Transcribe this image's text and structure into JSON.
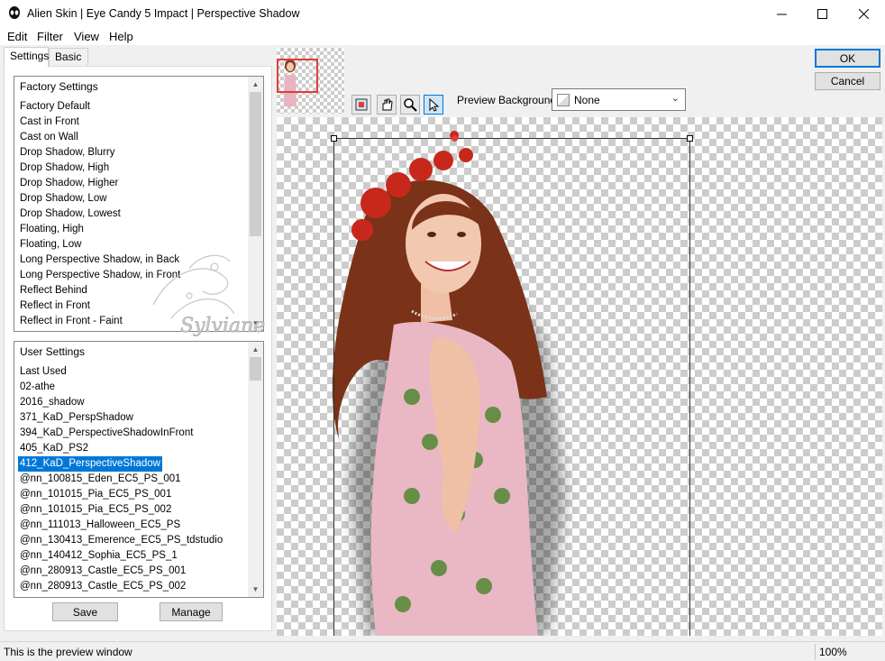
{
  "window": {
    "title": "Alien Skin | Eye Candy 5 Impact | Perspective Shadow"
  },
  "menu": {
    "edit": "Edit",
    "filter": "Filter",
    "view": "View",
    "help": "Help"
  },
  "tabs": {
    "settings": "Settings",
    "basic": "Basic"
  },
  "factory": {
    "header": "Factory Settings",
    "items": [
      "Factory Default",
      "Cast in Front",
      "Cast on Wall",
      "Drop Shadow, Blurry",
      "Drop Shadow, High",
      "Drop Shadow, Higher",
      "Drop Shadow, Low",
      "Drop Shadow, Lowest",
      "Floating, High",
      "Floating, Low",
      "Long Perspective Shadow, in Back",
      "Long Perspective Shadow, in Front",
      "Reflect Behind",
      "Reflect in Front",
      "Reflect in Front - Faint"
    ]
  },
  "user": {
    "header": "User Settings",
    "items": [
      "Last Used",
      "02-athe",
      "2016_shadow",
      "371_KaD_PerspShadow",
      "394_KaD_PerspectiveShadowInFront",
      "405_KaD_PS2",
      "412_KaD_PerspectiveShadow",
      "@nn_100815_Eden_EC5_PS_001",
      "@nn_101015_Pia_EC5_PS_001",
      "@nn_101015_Pia_EC5_PS_002",
      "@nn_111013_Halloween_EC5_PS",
      "@nn_130413_Emerence_EC5_PS_tdstudio",
      "@nn_140412_Sophia_EC5_PS_1",
      "@nn_280913_Castle_EC5_PS_001",
      "@nn_280913_Castle_EC5_PS_002"
    ],
    "selected_index": 6
  },
  "buttons": {
    "save": "Save",
    "manage": "Manage",
    "ok": "OK",
    "cancel": "Cancel"
  },
  "preview_bg": {
    "label": "Preview Background:",
    "value": "None"
  },
  "watermark": "Sylviane",
  "status": {
    "text": "This is the preview window",
    "zoom": "100%"
  },
  "icons": {
    "app": "alien-head-icon",
    "tools": [
      "navigate-icon",
      "hand-icon",
      "zoom-icon",
      "pointer-icon"
    ]
  }
}
